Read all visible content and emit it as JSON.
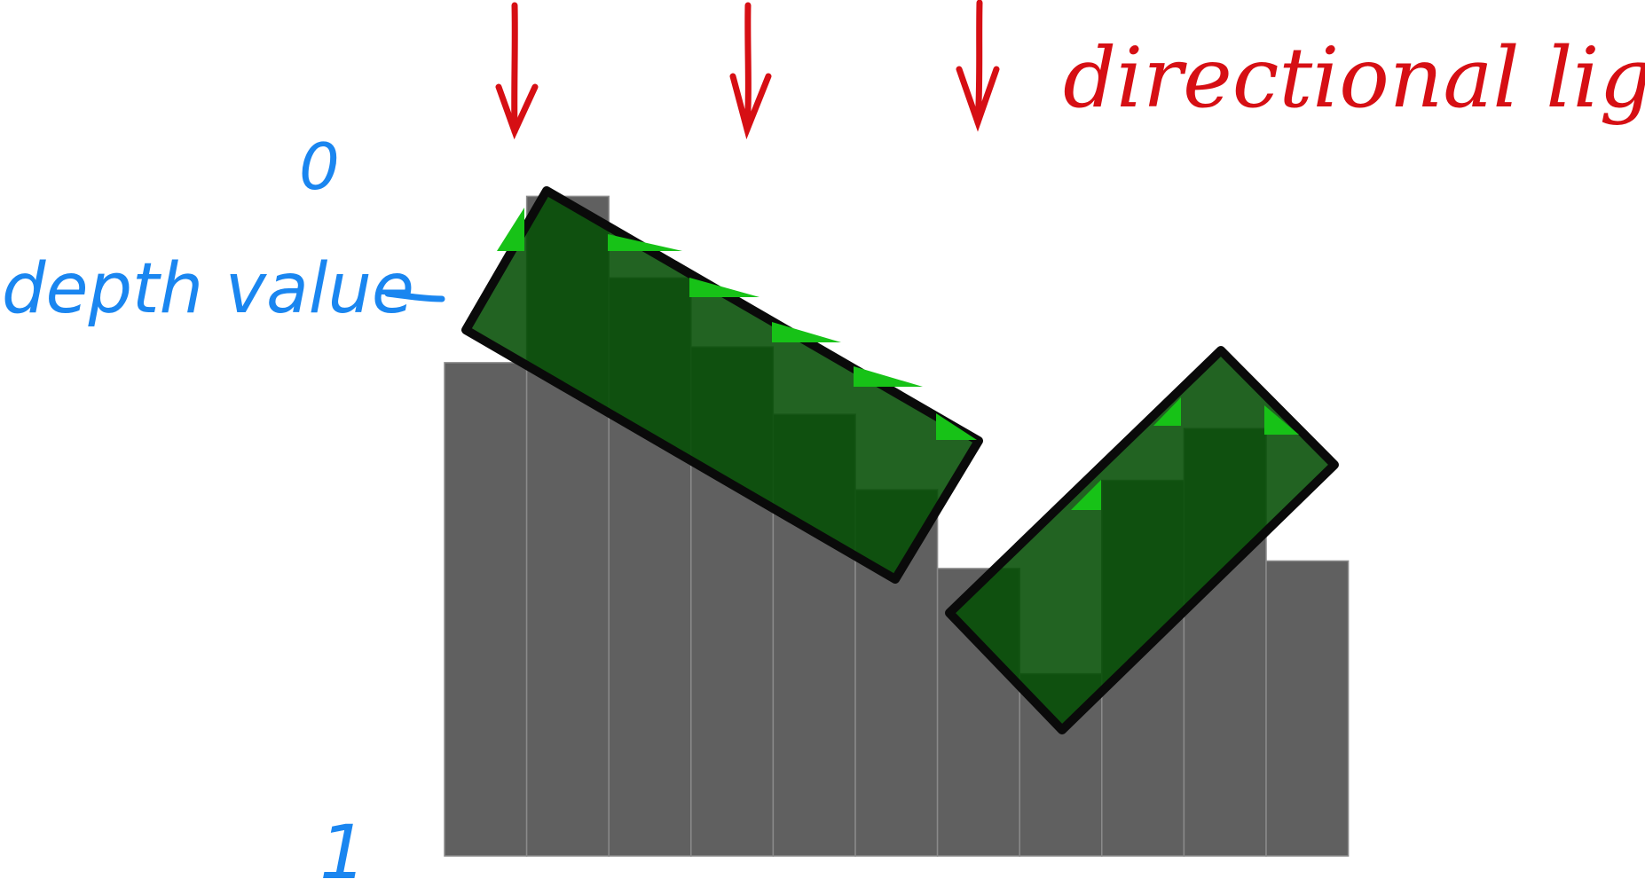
{
  "labels": {
    "light": "directional light",
    "depth": "depth value",
    "depth_min": "0",
    "depth_max": "1"
  },
  "depth_texels": [
    0.2585,
    0.0085,
    0.1311,
    0.2349,
    0.3362,
    0.4495,
    0.5679,
    0.7262,
    0.4354,
    0.3575,
    0.5566
  ],
  "colors": {
    "texel": "#606060",
    "texel_border": "#8a8a8a",
    "occluder_fill": "#034d03",
    "occluder_stroke": "#0a0a0a",
    "self_shadow": "#17c217",
    "light_arrow": "#d60f14",
    "depth_label": "#1a86f0"
  }
}
